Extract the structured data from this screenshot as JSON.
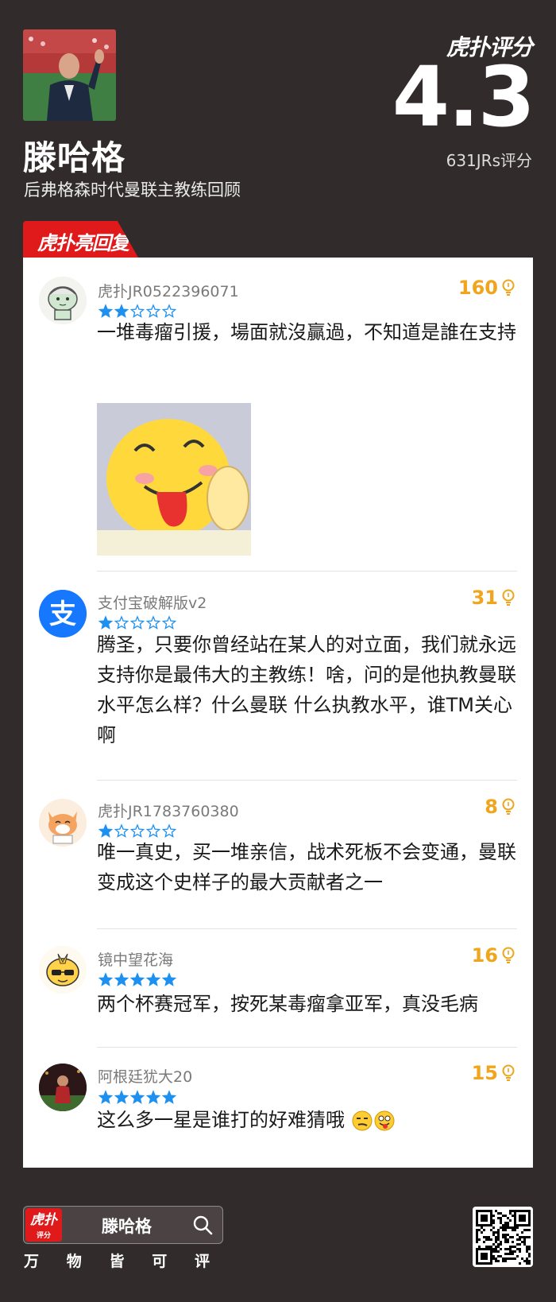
{
  "header": {
    "name": "滕哈格",
    "subtitle": "后弗格森时代曼联主教练回顾",
    "brand": "虎扑评分",
    "score": "4.3",
    "rating_count": "631JRs评分"
  },
  "section_tab": "虎扑亮回复",
  "comments": [
    {
      "username": "虎扑JR0522396071",
      "stars": 2,
      "likes": "160",
      "text": "一堆毒瘤引援，場面就沒贏過，不知道是誰在支持",
      "avatar": "cartoon-avatar"
    },
    {
      "username": "支付宝破解版v2",
      "stars": 1,
      "likes": "31",
      "text": "腾圣，只要你曾经站在某人的对立面，我们就永远支持你是最伟大的主教练！啥，问的是他执教曼联水平怎么样？什么曼联 什么执教水平，谁TM关心啊",
      "avatar": "alipay-logo"
    },
    {
      "username": "虎扑JR1783760380",
      "stars": 1,
      "likes": "8",
      "text": "唯一真史，买一堆亲信，战术死板不会变通，曼联变成这个史样子的最大贡献者之一",
      "avatar": "fox-avatar"
    },
    {
      "username": "镜中望花海",
      "stars": 5,
      "likes": "16",
      "text": "两个杯赛冠军，按死某毒瘤拿亚军，真没毛病",
      "avatar": "sunglasses-avatar"
    },
    {
      "username": "阿根廷犹大20",
      "stars": 5,
      "likes": "15",
      "text": "这么多一星是谁打的好难猜哦",
      "avatar": "photo-avatar"
    }
  ],
  "footer": {
    "logo_text": "虎扑",
    "logo_sub": "评分",
    "search_query": "滕哈格",
    "slogan": [
      "万",
      "物",
      "皆",
      "可",
      "评"
    ]
  },
  "colors": {
    "background": "#322b2c",
    "accent_red": "#e0191b",
    "like_orange": "#f0a51c",
    "star_blue": "#1e90f0"
  }
}
